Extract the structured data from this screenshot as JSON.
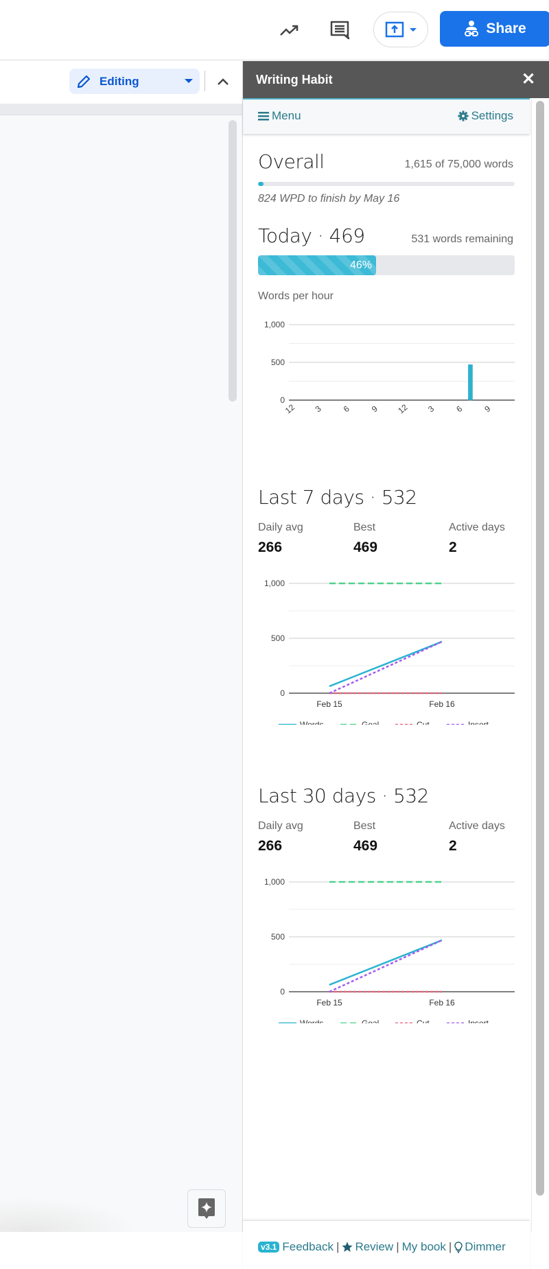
{
  "topbar": {
    "activity_icon": "trending-up-icon",
    "comments_icon": "comment-icon",
    "present_icon": "present-upload-icon",
    "share_label": "Share",
    "share_icon": "person-link-icon"
  },
  "toolbar": {
    "mode_label": "Editing",
    "mode_icon": "pencil-icon",
    "collapse_icon": "chevron-up-icon"
  },
  "panel": {
    "title": "Writing Habit",
    "close_label": "✕",
    "menu_label": "Menu",
    "settings_label": "Settings",
    "overall": {
      "title": "Overall",
      "summary": "1,615 of 75,000 words",
      "progress_fraction": 0.0215,
      "note": "824 WPD to finish by May 16"
    },
    "today": {
      "title": "Today · 469",
      "remaining": "531 words remaining",
      "progress_percent": 46,
      "progress_label": "46%"
    },
    "words_per_hour_label": "Words per hour",
    "last7": {
      "title": "Last 7 days · 532",
      "stats": [
        {
          "label": "Daily avg",
          "value": "266"
        },
        {
          "label": "Best",
          "value": "469"
        },
        {
          "label": "Active days",
          "value": "2"
        }
      ]
    },
    "last30": {
      "title": "Last 30 days · 532",
      "stats": [
        {
          "label": "Daily avg",
          "value": "266"
        },
        {
          "label": "Best",
          "value": "469"
        },
        {
          "label": "Active days",
          "value": "2"
        }
      ]
    },
    "footer": {
      "version": "v3.1",
      "feedback": "Feedback",
      "review": "Review",
      "my_book": "My book",
      "dimmer": "Dimmer",
      "separator": "|"
    }
  },
  "colors": {
    "accent": "#2ab3d0",
    "link": "#2b7a8c",
    "share_blue": "#1a73e8",
    "header_bg": "#575757"
  },
  "chart_data": [
    {
      "type": "bar",
      "title": "Words per hour",
      "xlabel": "",
      "ylabel": "",
      "ylim": [
        0,
        1000
      ],
      "yticks": [
        0,
        500,
        1000
      ],
      "ytick_labels": [
        "0",
        "500",
        "1,000"
      ],
      "xlim": [
        0,
        24
      ],
      "xticks": [
        0,
        3,
        6,
        9,
        12,
        15,
        18,
        21
      ],
      "xtick_labels": [
        "12",
        "3",
        "6",
        "9",
        "12",
        "3",
        "6",
        "9"
      ],
      "bars": [
        {
          "hour": 19,
          "value": 469
        }
      ],
      "color": "#2ab3d0",
      "grid": true
    },
    {
      "type": "line",
      "title": "Last 7 days",
      "categories": [
        "Feb 15",
        "Feb 16"
      ],
      "ylim": [
        0,
        1000
      ],
      "yticks": [
        0,
        500,
        1000
      ],
      "ytick_labels": [
        "0",
        "500",
        "1,000"
      ],
      "series": [
        {
          "name": "Words",
          "values": [
            63,
            469
          ],
          "color": "#2ab3d0",
          "dash": "solid"
        },
        {
          "name": "Goal",
          "values": [
            1000,
            1000
          ],
          "color": "#4cd28c",
          "dash": "long"
        },
        {
          "name": "Cut",
          "values": [
            0,
            0
          ],
          "color": "#f0607a",
          "dash": "short"
        },
        {
          "name": "Insert",
          "values": [
            0,
            469
          ],
          "color": "#a45cf0",
          "dash": "short"
        }
      ],
      "legend": "bottom",
      "grid": true
    },
    {
      "type": "line",
      "title": "Last 30 days",
      "categories": [
        "Feb 15",
        "Feb 16"
      ],
      "ylim": [
        0,
        1000
      ],
      "yticks": [
        0,
        500,
        1000
      ],
      "ytick_labels": [
        "0",
        "500",
        "1,000"
      ],
      "series": [
        {
          "name": "Words",
          "values": [
            63,
            469
          ],
          "color": "#2ab3d0",
          "dash": "solid"
        },
        {
          "name": "Goal",
          "values": [
            1000,
            1000
          ],
          "color": "#4cd28c",
          "dash": "long"
        },
        {
          "name": "Cut",
          "values": [
            0,
            0
          ],
          "color": "#f0607a",
          "dash": "short"
        },
        {
          "name": "Insert",
          "values": [
            0,
            469
          ],
          "color": "#a45cf0",
          "dash": "short"
        }
      ],
      "legend": "bottom",
      "grid": true
    }
  ]
}
